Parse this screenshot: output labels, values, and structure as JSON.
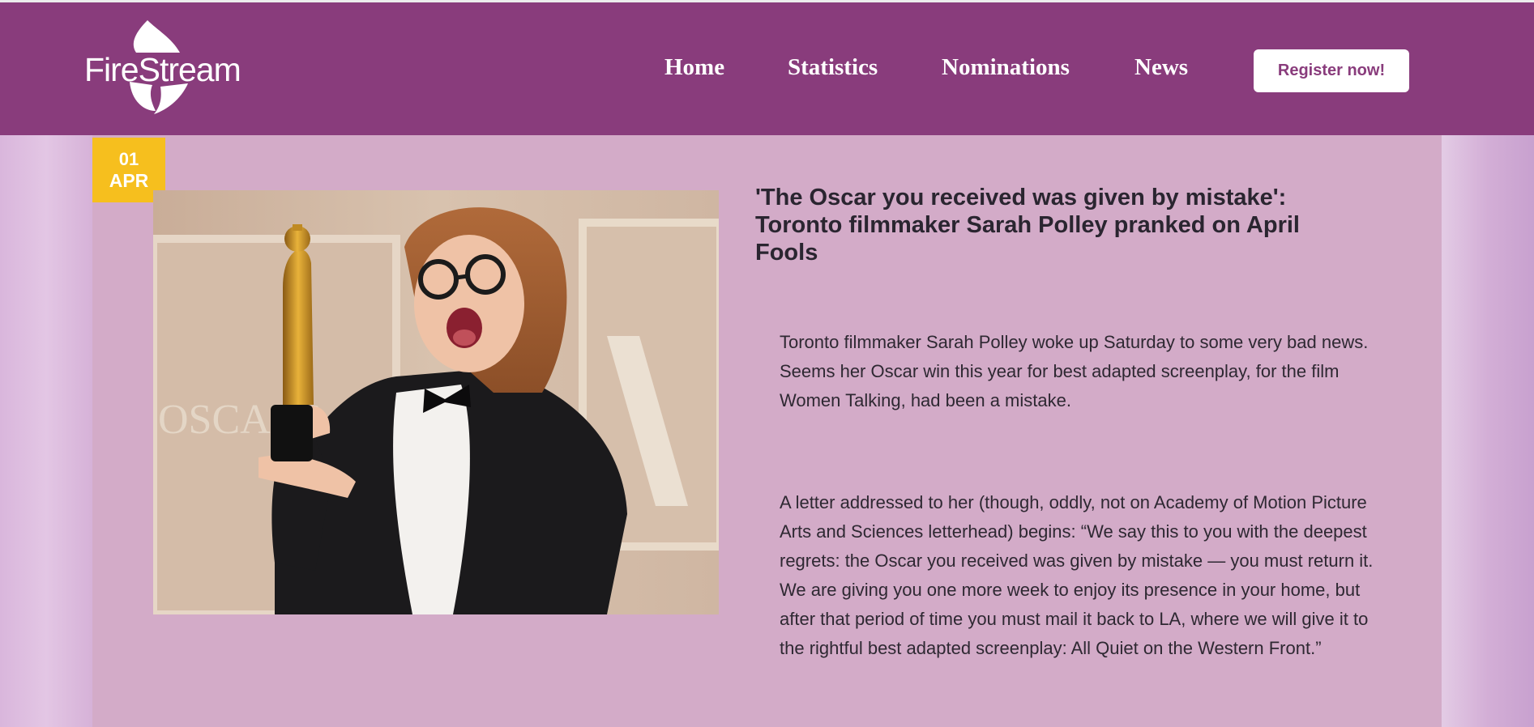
{
  "brand": {
    "name": "FireStream"
  },
  "nav": {
    "items": [
      {
        "label": "Home"
      },
      {
        "label": "Statistics"
      },
      {
        "label": "Nominations"
      },
      {
        "label": "News"
      }
    ],
    "register_label": "Register now!"
  },
  "article": {
    "date_day": "01",
    "date_month": "APR",
    "title": "'The Oscar you received was given by mistake': Toronto filmmaker Sarah Polley pranked on April Fools",
    "paragraphs": [
      "Toronto filmmaker Sarah Polley woke up Saturday to some very bad news. Seems her Oscar win this year for best adapted screenplay, for the film Women Talking, had been a mistake.",
      "A letter addressed to her (though, oddly, not on Academy of Motion Picture Arts and Sciences letterhead) begins: “We say this to you with the deepest regrets: the Oscar you received was given by mistake — you must return it. We are giving you one more week to enjoy its presence in your home, but after that period of time you must mail it back to LA, where we will give it to the rightful best adapted screenplay: All Quiet on the Western Front.”"
    ],
    "photo_backdrop_text": "OSCARS"
  },
  "colors": {
    "header": "#893c7c",
    "panel": "#d3abc8",
    "date_badge": "#f6bf1e",
    "register_text": "#893c7c",
    "title_text": "#2a2530"
  },
  "icons": {
    "logo": "flame-logo-icon"
  }
}
